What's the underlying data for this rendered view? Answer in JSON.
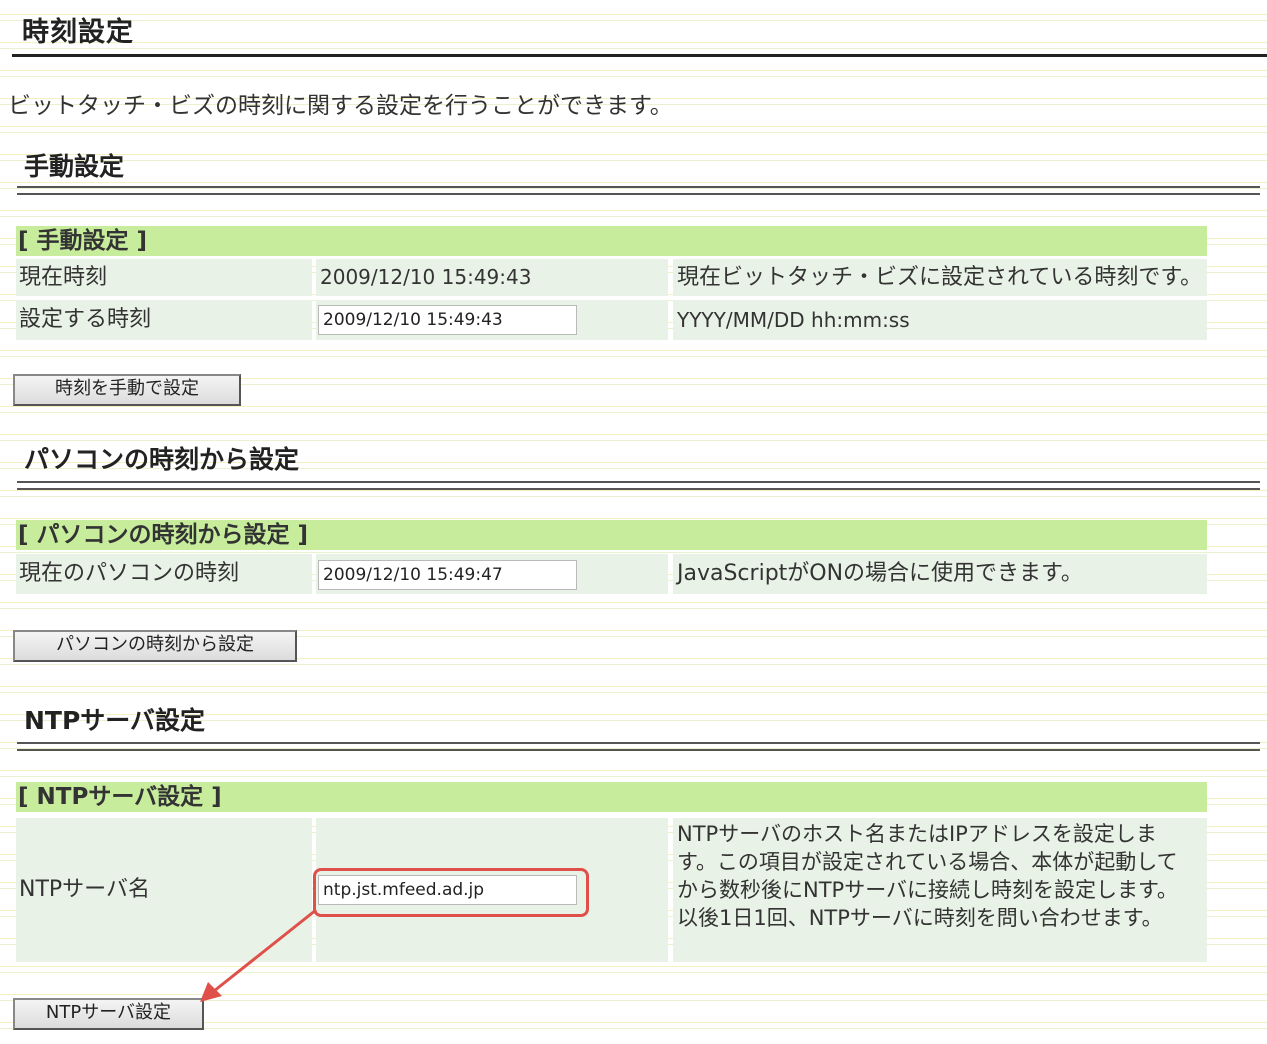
{
  "page": {
    "title": "時刻設定",
    "intro": "ビットタッチ・ビズの時刻に関する設定を行うことができます。"
  },
  "manual": {
    "section_title": "手動設定",
    "box_title": "[ 手動設定 ]",
    "rows": [
      {
        "label": "現在時刻",
        "value": "2009/12/10 15:49:43",
        "desc": "現在ビットタッチ・ビズに設定されている時刻です。"
      },
      {
        "label": "設定する時刻",
        "input_value": "2009/12/10 15:49:43",
        "desc": "YYYY/MM/DD hh:mm:ss"
      }
    ],
    "button": "時刻を手動で設定"
  },
  "pc": {
    "section_title": "パソコンの時刻から設定",
    "box_title": "[ パソコンの時刻から設定 ]",
    "label": "現在のパソコンの時刻",
    "input_value": "2009/12/10 15:49:47",
    "desc": "JavaScriptがONの場合に使用できます。",
    "button": "パソコンの時刻から設定"
  },
  "ntp": {
    "section_title": "NTPサーバ設定",
    "box_title": "[ NTPサーバ設定 ]",
    "label": "NTPサーバ名",
    "input_value": "ntp.jst.mfeed.ad.jp",
    "desc": "NTPサーバのホスト名またはIPアドレスを設定します。この項目が設定されている場合、本体が起動してから数秒後にNTPサーバに接続し時刻を設定します。以後1日1回、NTPサーバに時刻を問い合わせます。",
    "button": "NTPサーバ設定"
  },
  "colors": {
    "box_header": "#c6ec9c",
    "cell_bg": "#e9f2e6",
    "annotation": "#e0504a"
  }
}
